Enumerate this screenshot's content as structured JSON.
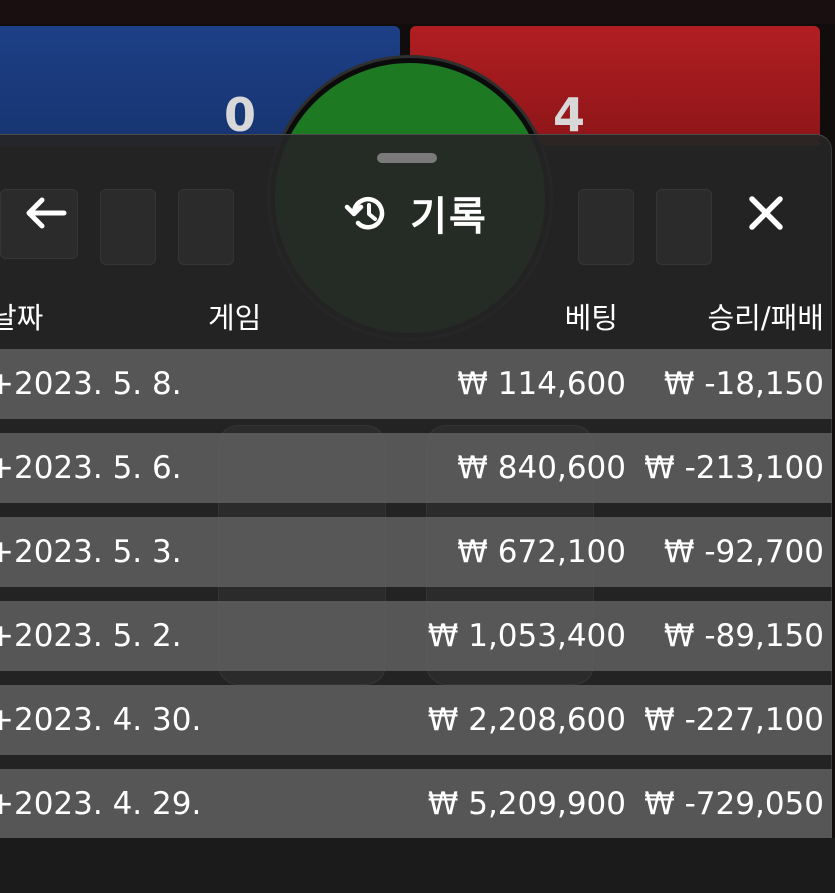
{
  "background": {
    "player_score": "0",
    "banker_score": "4"
  },
  "sheet": {
    "title": "기록",
    "title_icon": "history-icon",
    "back_icon": "arrow-left-icon",
    "close_icon": "close-icon"
  },
  "table": {
    "headers": {
      "date": "날짜",
      "game": "게임",
      "bet": "베팅",
      "result": "승리/패배"
    },
    "rows": [
      {
        "date": "+2023. 5. 8.",
        "bet": "₩ 114,600",
        "result": "₩ -18,150"
      },
      {
        "date": "+2023. 5. 6.",
        "bet": "₩ 840,600",
        "result": "₩ -213,100"
      },
      {
        "date": "+2023. 5. 3.",
        "bet": "₩ 672,100",
        "result": "₩ -92,700"
      },
      {
        "date": "+2023. 5. 2.",
        "bet": "₩ 1,053,400",
        "result": "₩ -89,150"
      },
      {
        "date": "+2023. 4. 30.",
        "bet": "₩ 2,208,600",
        "result": "₩ -227,100"
      },
      {
        "date": "+2023. 4. 29.",
        "bet": "₩ 5,209,900",
        "result": "₩ -729,050"
      }
    ]
  },
  "colors": {
    "player_blue": "#1d3f86",
    "banker_red": "#b11e22",
    "tie_green": "#1d7a22",
    "sheet_bg": "#262626",
    "row_bg": "#5f5f5f"
  }
}
